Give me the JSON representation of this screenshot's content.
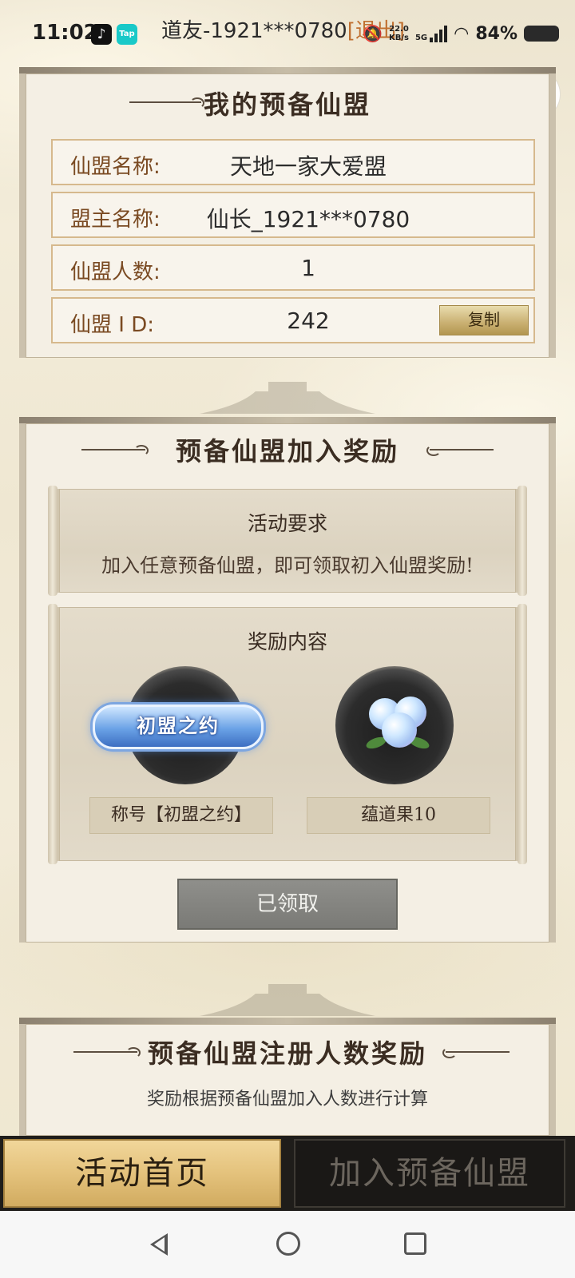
{
  "status_bar": {
    "time": "11:02",
    "user_title": "道友-1921***0780",
    "logout_label": "[退出]",
    "net_speed_value": "22.0",
    "net_speed_unit": "KB/s",
    "network_type": "5G",
    "battery": "84%",
    "icons": [
      "tiktok-icon",
      "taptap-icon",
      "mute-icon",
      "wifi-icon",
      "battery-icon"
    ],
    "taptap_label": "Tap"
  },
  "capsule": {
    "more_icon": "more-dots-icon",
    "close_icon": "target-close-icon"
  },
  "my_alliance": {
    "title": "我的预备仙盟",
    "rows": [
      {
        "label": "仙盟名称:",
        "value": "天地一家大爱盟"
      },
      {
        "label": "盟主名称:",
        "value": "仙长_1921***0780"
      },
      {
        "label": "仙盟人数:",
        "value": "1"
      },
      {
        "label": "仙盟 I D:",
        "value": "242"
      }
    ],
    "copy_label": "复制"
  },
  "join_reward": {
    "title": "预备仙盟加入奖励",
    "requirement_title": "活动要求",
    "requirement_text": "加入任意预备仙盟，即可领取初入仙盟奖励!",
    "reward_title": "奖励内容",
    "rewards": [
      {
        "name": "称号【初盟之约】",
        "badge_text": "初盟之约"
      },
      {
        "name": "蕴道果10"
      }
    ],
    "claimed_label": "已领取"
  },
  "register_reward": {
    "title": "预备仙盟注册人数奖励",
    "desc": "奖励根据预备仙盟加入人数进行计算"
  },
  "bottom_nav": {
    "home_label": "活动首页",
    "join_label": "加入预备仙盟"
  },
  "colors": {
    "accent_gold": "#d1ab60",
    "label_brown": "#7a4a22",
    "claimed_gray": "#7a7a76"
  }
}
